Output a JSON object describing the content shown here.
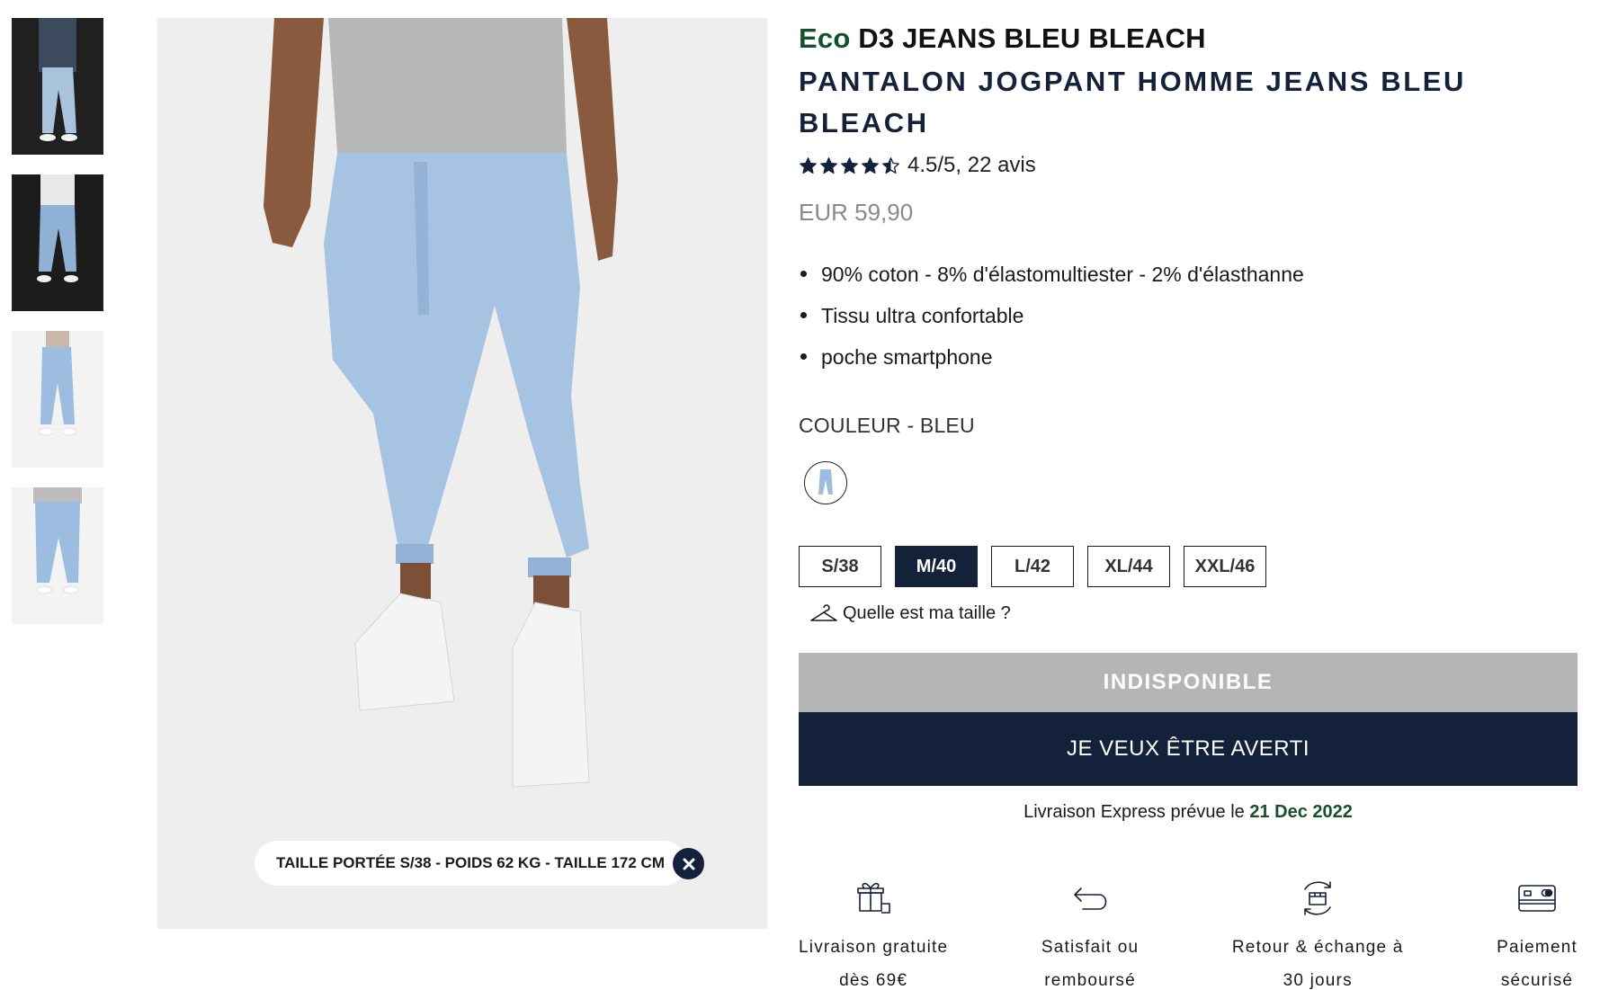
{
  "gallery": {
    "thumbnails": [
      {
        "label": "",
        "background": "#1f1f1f"
      },
      {
        "label": "",
        "background": "#1f1f1f"
      },
      {
        "label": "",
        "background": "#f1f1f1"
      },
      {
        "label": "",
        "background": "#f1f1f1"
      }
    ],
    "main_image_note": "TAILLE PORTÉE S/38 - POIDS 62 KG - TAILLE 172 CM",
    "close_icon": "close-icon"
  },
  "product": {
    "brand_prefix": "Eco",
    "name": "D3 JEANS BLEU BLEACH",
    "subtitle": "PANTALON JOGPANT HOMME JEANS BLEU BLEACH",
    "rating_value": 4.5,
    "rating_max": 5,
    "rating_text": "4.5/5, 22 avis",
    "price": "EUR 59,90",
    "features": [
      "90% coton - 8% d'élastomultiester - 2% d'élasthanne",
      "Tissu ultra confortable",
      "poche smartphone"
    ],
    "color_label": "COULEUR - BLEU",
    "sizes": [
      {
        "label": "S/38",
        "selected": false
      },
      {
        "label": "M/40",
        "selected": true
      },
      {
        "label": "L/42",
        "selected": false
      },
      {
        "label": "XL/44",
        "selected": false
      },
      {
        "label": "XXL/46",
        "selected": false
      }
    ],
    "size_guide_label": "Quelle est ma taille ?",
    "unavailable_label": "INDISPONIBLE",
    "notify_label": "JE VEUX ÊTRE AVERTI",
    "delivery_prefix": "Livraison Express prévue le",
    "delivery_date": "21 Dec 2022"
  },
  "reassurance": [
    {
      "icon": "gift-icon",
      "line1": "Livraison gratuite",
      "line2": "dès 69€"
    },
    {
      "icon": "return-arrow-icon",
      "line1": "Satisfait ou",
      "line2": "remboursé"
    },
    {
      "icon": "exchange-box-icon",
      "line1": "Retour & échange à",
      "line2": "30 jours"
    },
    {
      "icon": "credit-card-icon",
      "line1": "Paiement",
      "line2": "sécurisé"
    }
  ],
  "colors": {
    "brand_green": "#16502c",
    "navy": "#14213a",
    "unavailable_grey": "#b5b5b5",
    "price_grey": "#8a8a8a"
  }
}
